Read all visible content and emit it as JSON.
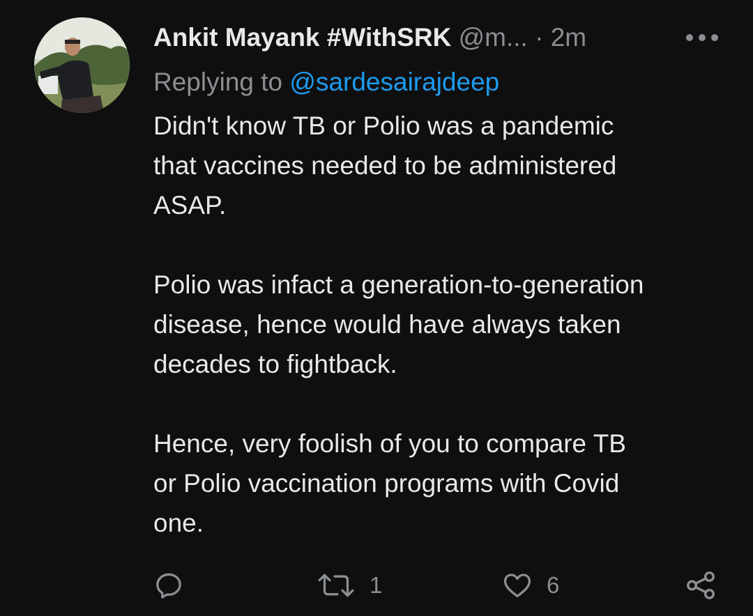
{
  "tweet": {
    "display_name": "Ankit Mayank #WithSRK",
    "handle": "@m...",
    "separator": "·",
    "time": "2m",
    "replying_prefix": "Replying to ",
    "replying_to": "@sardesairajdeep",
    "paragraphs": [
      [
        "Didn't know TB or Polio was a pandemic",
        "that vaccines needed to be administered",
        "ASAP."
      ],
      [
        "Polio was infact a generation-to-generation",
        "disease, hence would have always taken",
        "decades to fightback."
      ],
      [
        "Hence, very foolish of you to compare TB",
        "or Polio vaccination programs with Covid",
        "one."
      ]
    ]
  },
  "actions": {
    "reply_icon": "reply-icon",
    "retweet_icon": "retweet-icon",
    "retweet_count": "1",
    "like_icon": "heart-icon",
    "like_count": "6",
    "share_icon": "share-icon"
  },
  "colors": {
    "background": "#0f0f0f",
    "text": "#e7e9ea",
    "muted": "#8b8f93",
    "link": "#1d9bf0"
  }
}
